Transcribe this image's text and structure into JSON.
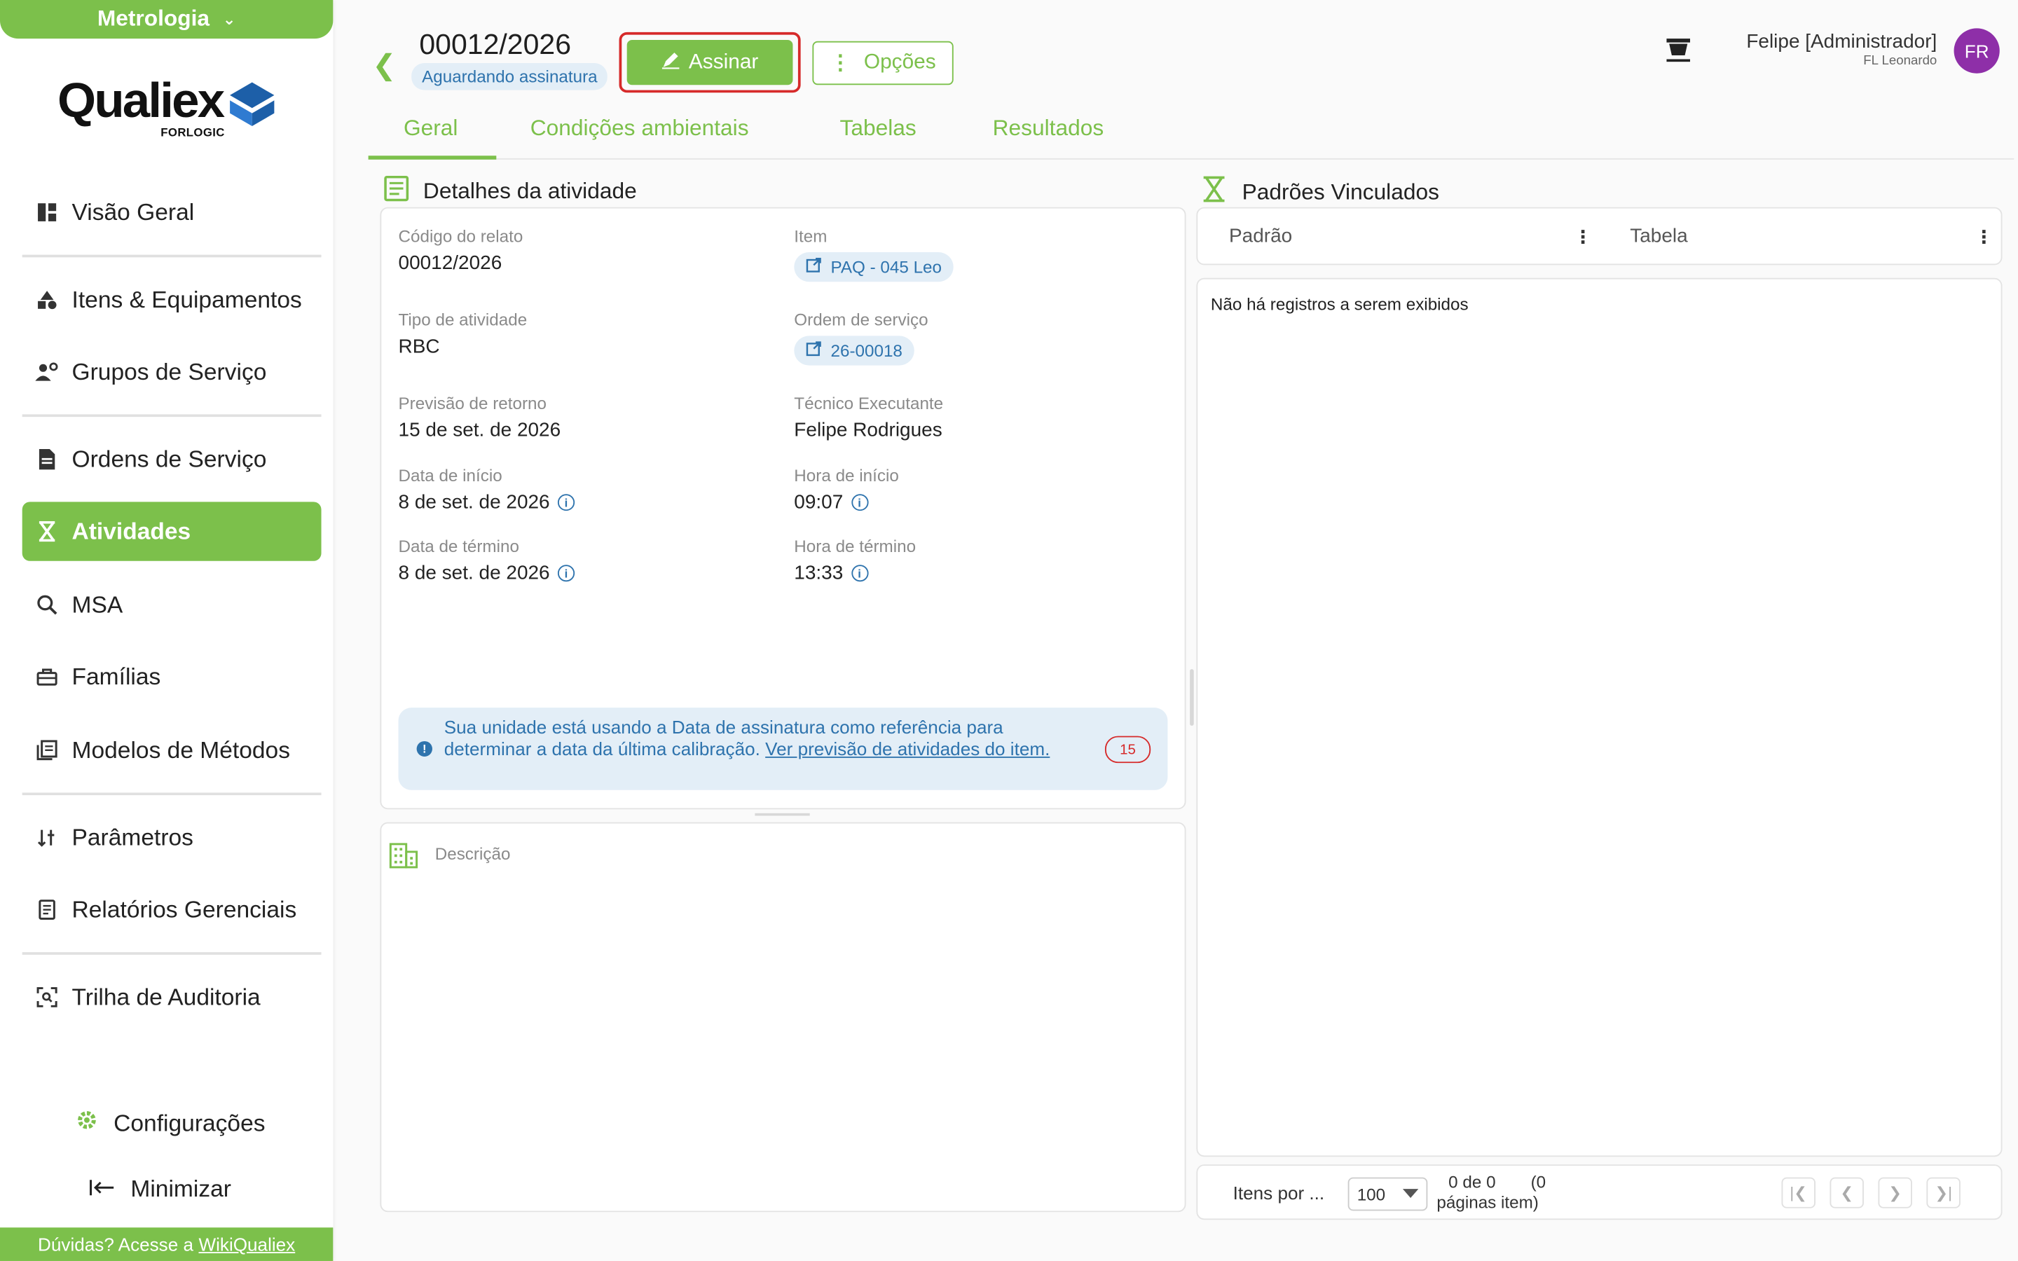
{
  "sidebar": {
    "module": "Metrologia",
    "logo_word": "Qualiex",
    "logo_sub": "FORLOGIC",
    "items": [
      {
        "label": "Visão Geral"
      },
      {
        "label": "Itens & Equipamentos"
      },
      {
        "label": "Grupos de Serviço"
      },
      {
        "label": "Ordens de Serviço"
      },
      {
        "label": "Atividades"
      },
      {
        "label": "MSA"
      },
      {
        "label": "Famílias"
      },
      {
        "label": "Modelos de Métodos"
      },
      {
        "label": "Parâmetros"
      },
      {
        "label": "Relatórios Gerenciais"
      },
      {
        "label": "Trilha de Auditoria"
      }
    ],
    "settings": "Configurações",
    "minimize": "Minimizar",
    "help_text": "Dúvidas? Acesse a",
    "help_link": "WikiQualiex"
  },
  "header": {
    "title": "00012/2026",
    "status": "Aguardando assinatura",
    "sign_label": "Assinar",
    "options_label": "Opções",
    "user_name": "Felipe [Administrador]",
    "user_unit": "FL Leonardo",
    "avatar_initials": "FR"
  },
  "tabs": [
    "Geral",
    "Condições ambientais",
    "Tabelas",
    "Resultados"
  ],
  "details": {
    "title": "Detalhes da atividade",
    "fields": {
      "code_label": "Código do relato",
      "code_value": "00012/2026",
      "item_label": "Item",
      "item_value": "PAQ - 045 Leo",
      "type_label": "Tipo de atividade",
      "type_value": "RBC",
      "order_label": "Ordem de serviço",
      "order_value": "26-00018",
      "return_label": "Previsão de retorno",
      "return_value": "15 de set. de 2026",
      "tech_label": "Técnico Executante",
      "tech_value": "Felipe Rodrigues",
      "start_date_label": "Data de início",
      "start_date_value": "8 de set. de 2026",
      "start_time_label": "Hora de início",
      "start_time_value": "09:07",
      "end_date_label": "Data de término",
      "end_date_value": "8 de set. de 2026",
      "end_time_label": "Hora de término",
      "end_time_value": "13:33"
    },
    "notice_text": "Sua unidade está usando a Data de assinatura como referência para determinar a data da última calibração.",
    "notice_link": "Ver previsão de atividades do item.",
    "notice_count": "15",
    "description_label": "Descrição"
  },
  "linked": {
    "title": "Padrões Vinculados",
    "col_standard": "Padrão",
    "col_table": "Tabela",
    "empty": "Não há registros a serem exibidos",
    "per_page_label": "Itens por ...",
    "per_page_value": "100",
    "range_line1": "0 de 0",
    "range_line1b": "(0",
    "range_line2": "páginas item)"
  },
  "colors": {
    "accent": "#7cc04b",
    "link": "#2e73ad",
    "highlight": "#d62a2a",
    "avatar": "#8e2fa8"
  }
}
